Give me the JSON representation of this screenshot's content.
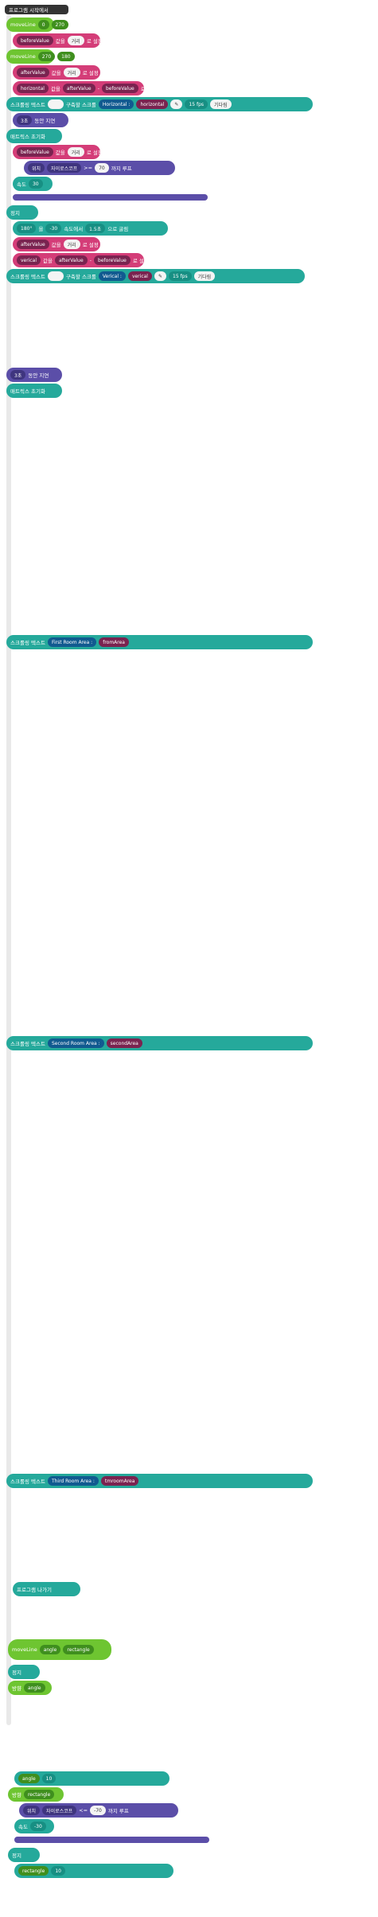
{
  "start": {
    "label": "프로그램 시작에서"
  },
  "blocks": [
    {
      "label": "moveLine",
      "a": "0",
      "b": "270"
    },
    {
      "var": "beforeValue",
      "kw": "값을",
      "val": "거리",
      "set": "로 설정"
    },
    {
      "label": "moveLine",
      "a": "270",
      "b": "180"
    },
    {
      "var": "afterValue",
      "kw": "값을",
      "val": "거리",
      "set": "로 설정"
    },
    {
      "var": "horizontal",
      "kw": "값을",
      "val": "afterValue",
      "op": "-",
      "val2": "beforeValue",
      "set": "로 설정"
    },
    {
      "scroll": "스크롤링 텍스트",
      "desc": "구축할 스크롤",
      "text": "Horizontal :",
      "var": "horizontal",
      "fps": "15 fps",
      "wait": "기다림"
    },
    {
      "delay": "3초",
      "after": "동안 지연"
    },
    {
      "reset": "매트릭스 초기화"
    },
    {
      "var": "beforeValue",
      "kw": "값을",
      "val": "거리",
      "set": "로 설정"
    },
    {
      "loop": "까지 루프",
      "a": "위치",
      "b": "자이로스코프",
      "cmp": ">=",
      "val": "70"
    },
    {
      "speed": "속도",
      "val": "30"
    },
    {
      "stop": "정지"
    },
    {
      "rot": "180°",
      "a": "을",
      "b": "-30",
      "c": "속도에서",
      "d": "1.5초",
      "e": "으로 굴림"
    },
    {
      "var": "afterValue",
      "kw": "값을",
      "val": "거리",
      "set": "로 설정"
    },
    {
      "var": "verical",
      "kw": "값을",
      "val": "afterValue",
      "op": "-",
      "val2": "beforeValue",
      "set": "로 설정"
    },
    {
      "scroll": "스크롤링 텍스트",
      "desc": "구축할 스크롤",
      "text": "Verical :",
      "var": "verical",
      "fps": "15 fps",
      "wait": "기다림"
    }
  ],
  "section2": {
    "delay": "3초",
    "after": "동안 지연",
    "reset": "매트릭스 초기화",
    "room1": "First Room Area :",
    "room2": "Second Room Area :",
    "room3": "Third Room Area :",
    "roomVar1": "fromArea",
    "roomVar2": "secondArea",
    "roomVar3": "tmroomArea",
    "zero": "0",
    "end": "프로그램 나가기"
  },
  "func": {
    "label": "moveLine",
    "a": "angle",
    "b": "rectangle",
    "stop": "정지",
    "dir": "방향",
    "angle": "angle",
    "rect": "rectangle",
    "cmp2": "<=",
    "neg": "-70",
    "neg30": "-30",
    "ten": "10"
  }
}
